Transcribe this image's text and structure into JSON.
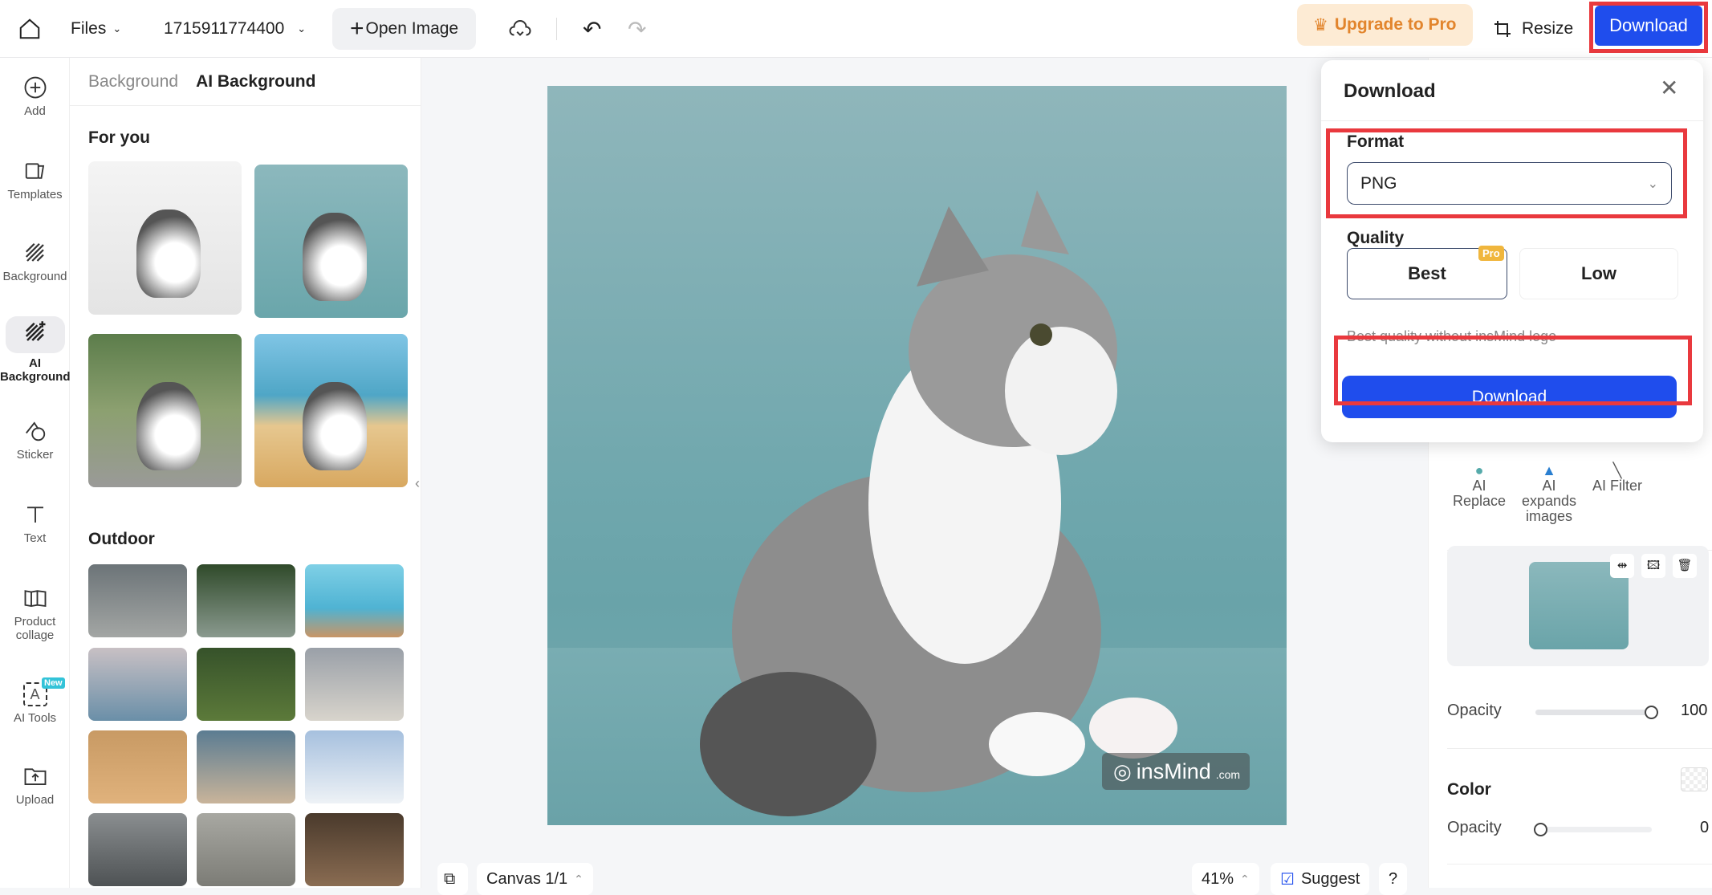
{
  "topbar": {
    "files": "Files",
    "project_name": "1715911774400",
    "open_image": "Open Image",
    "upgrade": "Upgrade to Pro",
    "resize": "Resize",
    "download": "Download"
  },
  "rail": [
    {
      "label": "Add",
      "icon": "plus-circle-icon"
    },
    {
      "label": "Templates",
      "icon": "templates-icon"
    },
    {
      "label": "Background",
      "icon": "background-icon"
    },
    {
      "label": "AI Background",
      "icon": "ai-background-icon",
      "active": true
    },
    {
      "label": "Sticker",
      "icon": "sticker-icon"
    },
    {
      "label": "Text",
      "icon": "text-icon"
    },
    {
      "label": "Product collage",
      "icon": "collage-icon"
    },
    {
      "label": "AI Tools",
      "icon": "ai-tools-icon",
      "badge": "New"
    },
    {
      "label": "Upload",
      "icon": "upload-icon"
    }
  ],
  "panel": {
    "tabs": [
      "Background",
      "AI Background"
    ],
    "active_tab": "AI Background",
    "for_you": "For you",
    "outdoor": "Outdoor"
  },
  "canvas": {
    "watermark": "insMind",
    "watermark_suffix": ".com",
    "canvas_label": "Canvas 1/1",
    "zoom": "41%",
    "suggest": "Suggest",
    "help": "?"
  },
  "right": {
    "tools": [
      "AI Replace",
      "AI expands images",
      "AI Filter"
    ],
    "opacity_label": "Opacity",
    "opacity_value": "100",
    "opacity_fraction": 1.0,
    "color_label": "Color",
    "color_opacity_label": "Opacity",
    "color_opacity_value": "0",
    "color_opacity_fraction": 0
  },
  "popup": {
    "title": "Download",
    "format_label": "Format",
    "format_value": "PNG",
    "quality_label": "Quality",
    "quality_options": [
      "Best",
      "Low"
    ],
    "selected_quality": "Best",
    "pro_badge": "Pro",
    "hint": "Best quality without insMind logo",
    "download": "Download"
  },
  "colors": {
    "accent": "#1f4ded",
    "highlight": "#e9393e",
    "upgrade": "#e2852d"
  }
}
